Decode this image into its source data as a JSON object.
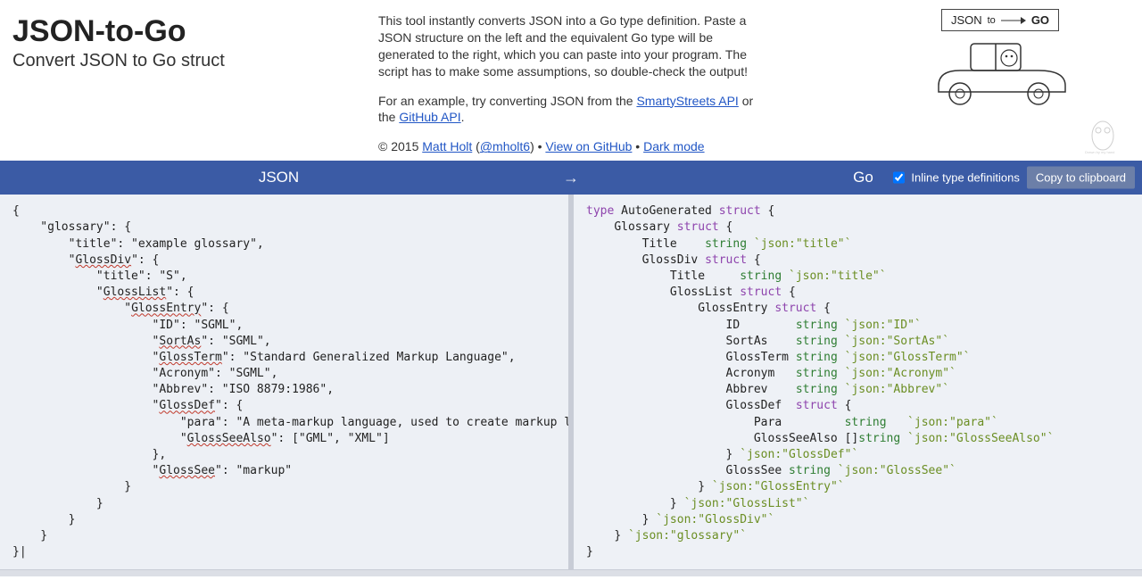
{
  "header": {
    "title": "JSON-to-Go",
    "subtitle": "Convert JSON to Go struct",
    "description": "This tool instantly converts JSON into a Go type definition. Paste a JSON structure on the left and the equivalent Go type will be generated to the right, which you can paste into your program. The script has to make some assumptions, so double-check the output!",
    "example_prefix": "For an example, try converting JSON from the ",
    "example_link1": "SmartyStreets API",
    "example_middle": " or the ",
    "example_link2": "GitHub API",
    "example_suffix": ".",
    "copyright_prefix": "© 2015 ",
    "author_name": "Matt Holt",
    "author_handle_open": " (",
    "author_handle": "@mholt6",
    "author_handle_close": ") • ",
    "github_link": "View on GitHub",
    "sep2": " • ",
    "dark_mode": "Dark mode"
  },
  "logo": {
    "json_label": "JSON",
    "to_label": "to",
    "go_label": "GO"
  },
  "bar": {
    "left_label": "JSON",
    "arrow": "→",
    "right_label": "Go",
    "inline_label": "Inline type definitions",
    "inline_checked": true,
    "copy_label": "Copy to clipboard"
  },
  "json_input": {
    "l01": "{",
    "l02": "    \"glossary\": {",
    "l03": "        \"title\": \"example glossary\",",
    "l04a": "        \"",
    "l04b": "GlossDiv",
    "l04c": "\": {",
    "l05": "            \"title\": \"S\",",
    "l06a": "            \"",
    "l06b": "GlossList",
    "l06c": "\": {",
    "l07a": "                \"",
    "l07b": "GlossEntry",
    "l07c": "\": {",
    "l08": "                    \"ID\": \"SGML\",",
    "l09a": "                    \"",
    "l09b": "SortAs",
    "l09c": "\": \"SGML\",",
    "l10a": "                    \"",
    "l10b": "GlossTerm",
    "l10c": "\": \"Standard Generalized Markup Language\",",
    "l11": "                    \"Acronym\": \"SGML\",",
    "l12": "                    \"Abbrev\": \"ISO 8879:1986\",",
    "l13a": "                    \"",
    "l13b": "GlossDef",
    "l13c": "\": {",
    "l14": "                        \"para\": \"A meta-markup language, used to create markup languages such",
    "l15a": "                        \"",
    "l15b": "GlossSeeAlso",
    "l15c": "\": [\"GML\", \"XML\"]",
    "l16": "                    },",
    "l17a": "                    \"",
    "l17b": "GlossSee",
    "l17c": "\": \"markup\"",
    "l18": "                }",
    "l19": "            }",
    "l20": "        }",
    "l21": "    }",
    "l22": "}|"
  },
  "go_output": {
    "lines": [
      {
        "indent": 0,
        "tokens": [
          {
            "t": "key",
            "v": "type"
          },
          {
            "t": "plain",
            "v": " AutoGenerated "
          },
          {
            "t": "key",
            "v": "struct"
          },
          {
            "t": "plain",
            "v": " {"
          }
        ]
      },
      {
        "indent": 1,
        "tokens": [
          {
            "t": "plain",
            "v": "Glossary "
          },
          {
            "t": "key",
            "v": "struct"
          },
          {
            "t": "plain",
            "v": " {"
          }
        ]
      },
      {
        "indent": 2,
        "tokens": [
          {
            "t": "plain",
            "v": "Title    "
          },
          {
            "t": "type",
            "v": "string"
          },
          {
            "t": "plain",
            "v": " "
          },
          {
            "t": "tag",
            "v": "`json:\"title\"`"
          }
        ]
      },
      {
        "indent": 2,
        "tokens": [
          {
            "t": "plain",
            "v": "GlossDiv "
          },
          {
            "t": "key",
            "v": "struct"
          },
          {
            "t": "plain",
            "v": " {"
          }
        ]
      },
      {
        "indent": 3,
        "tokens": [
          {
            "t": "plain",
            "v": "Title     "
          },
          {
            "t": "type",
            "v": "string"
          },
          {
            "t": "plain",
            "v": " "
          },
          {
            "t": "tag",
            "v": "`json:\"title\"`"
          }
        ]
      },
      {
        "indent": 3,
        "tokens": [
          {
            "t": "plain",
            "v": "GlossList "
          },
          {
            "t": "key",
            "v": "struct"
          },
          {
            "t": "plain",
            "v": " {"
          }
        ]
      },
      {
        "indent": 4,
        "tokens": [
          {
            "t": "plain",
            "v": "GlossEntry "
          },
          {
            "t": "key",
            "v": "struct"
          },
          {
            "t": "plain",
            "v": " {"
          }
        ]
      },
      {
        "indent": 5,
        "tokens": [
          {
            "t": "plain",
            "v": "ID        "
          },
          {
            "t": "type",
            "v": "string"
          },
          {
            "t": "plain",
            "v": " "
          },
          {
            "t": "tag",
            "v": "`json:\"ID\"`"
          }
        ]
      },
      {
        "indent": 5,
        "tokens": [
          {
            "t": "plain",
            "v": "SortAs    "
          },
          {
            "t": "type",
            "v": "string"
          },
          {
            "t": "plain",
            "v": " "
          },
          {
            "t": "tag",
            "v": "`json:\"SortAs\"`"
          }
        ]
      },
      {
        "indent": 5,
        "tokens": [
          {
            "t": "plain",
            "v": "GlossTerm "
          },
          {
            "t": "type",
            "v": "string"
          },
          {
            "t": "plain",
            "v": " "
          },
          {
            "t": "tag",
            "v": "`json:\"GlossTerm\"`"
          }
        ]
      },
      {
        "indent": 5,
        "tokens": [
          {
            "t": "plain",
            "v": "Acronym   "
          },
          {
            "t": "type",
            "v": "string"
          },
          {
            "t": "plain",
            "v": " "
          },
          {
            "t": "tag",
            "v": "`json:\"Acronym\"`"
          }
        ]
      },
      {
        "indent": 5,
        "tokens": [
          {
            "t": "plain",
            "v": "Abbrev    "
          },
          {
            "t": "type",
            "v": "string"
          },
          {
            "t": "plain",
            "v": " "
          },
          {
            "t": "tag",
            "v": "`json:\"Abbrev\"`"
          }
        ]
      },
      {
        "indent": 5,
        "tokens": [
          {
            "t": "plain",
            "v": "GlossDef  "
          },
          {
            "t": "key",
            "v": "struct"
          },
          {
            "t": "plain",
            "v": " {"
          }
        ]
      },
      {
        "indent": 6,
        "tokens": [
          {
            "t": "plain",
            "v": "Para         "
          },
          {
            "t": "type",
            "v": "string"
          },
          {
            "t": "plain",
            "v": "   "
          },
          {
            "t": "tag",
            "v": "`json:\"para\"`"
          }
        ]
      },
      {
        "indent": 6,
        "tokens": [
          {
            "t": "plain",
            "v": "GlossSeeAlso []"
          },
          {
            "t": "type",
            "v": "string"
          },
          {
            "t": "plain",
            "v": " "
          },
          {
            "t": "tag",
            "v": "`json:\"GlossSeeAlso\"`"
          }
        ]
      },
      {
        "indent": 5,
        "tokens": [
          {
            "t": "plain",
            "v": "} "
          },
          {
            "t": "tag",
            "v": "`json:\"GlossDef\"`"
          }
        ]
      },
      {
        "indent": 5,
        "tokens": [
          {
            "t": "plain",
            "v": "GlossSee "
          },
          {
            "t": "type",
            "v": "string"
          },
          {
            "t": "plain",
            "v": " "
          },
          {
            "t": "tag",
            "v": "`json:\"GlossSee\"`"
          }
        ]
      },
      {
        "indent": 4,
        "tokens": [
          {
            "t": "plain",
            "v": "} "
          },
          {
            "t": "tag",
            "v": "`json:\"GlossEntry\"`"
          }
        ]
      },
      {
        "indent": 3,
        "tokens": [
          {
            "t": "plain",
            "v": "} "
          },
          {
            "t": "tag",
            "v": "`json:\"GlossList\"`"
          }
        ]
      },
      {
        "indent": 2,
        "tokens": [
          {
            "t": "plain",
            "v": "} "
          },
          {
            "t": "tag",
            "v": "`json:\"GlossDiv\"`"
          }
        ]
      },
      {
        "indent": 1,
        "tokens": [
          {
            "t": "plain",
            "v": "} "
          },
          {
            "t": "tag",
            "v": "`json:\"glossary\"`"
          }
        ]
      },
      {
        "indent": 0,
        "tokens": [
          {
            "t": "plain",
            "v": "}"
          }
        ]
      }
    ]
  }
}
